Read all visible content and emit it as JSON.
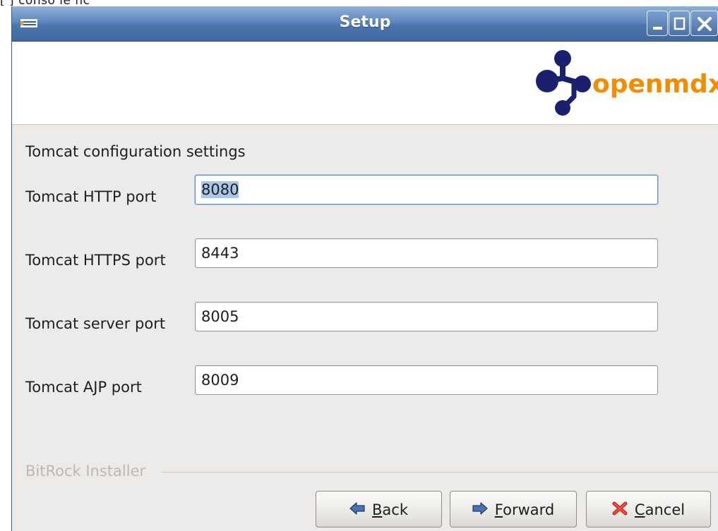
{
  "top_fragment": "[ ] conso le nc",
  "window": {
    "title": "Setup",
    "controls": {
      "minimize": "minimize-icon",
      "maximize": "maximize-icon",
      "close": "close-icon"
    }
  },
  "header": {
    "logo_text": "openmdx",
    "logo_colors": {
      "mark": "#1a1f6e",
      "text": "#f28c00"
    }
  },
  "main": {
    "section_title": "Tomcat configuration settings",
    "fields": [
      {
        "label": "Tomcat HTTP port",
        "value": "8080",
        "focused": true
      },
      {
        "label": "Tomcat HTTPS port",
        "value": "8443",
        "focused": false
      },
      {
        "label": "Tomcat server port",
        "value": "8005",
        "focused": false
      },
      {
        "label": "Tomcat AJP port",
        "value": "8009",
        "focused": false
      }
    ]
  },
  "footer": {
    "installer_label": "BitRock Installer",
    "buttons": {
      "back": {
        "label_mnemonic": "B",
        "label_rest": "ack",
        "icon": "arrow-left-icon"
      },
      "forward": {
        "label_mnemonic": "F",
        "label_rest": "orward",
        "icon": "arrow-right-icon"
      },
      "cancel": {
        "label_mnemonic": "C",
        "label_rest": "ancel",
        "icon": "cancel-x-icon"
      }
    }
  }
}
